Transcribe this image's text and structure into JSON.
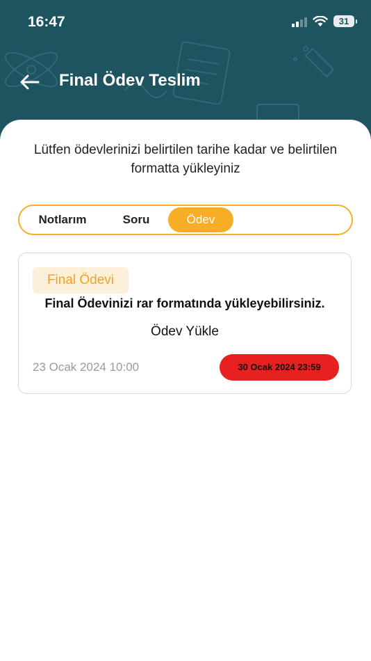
{
  "status_bar": {
    "time": "16:47",
    "battery": "31"
  },
  "header": {
    "title": "Final Ödev Teslim",
    "back_icon": "arrow-left-icon"
  },
  "intro": "Lütfen ödevlerinizi belirtilen tarihe kadar ve belirtilen formatta yükleyiniz",
  "tabs": [
    {
      "label": "Notlarım",
      "active": false
    },
    {
      "label": "Soru",
      "active": false
    },
    {
      "label": "Ödev",
      "active": true
    }
  ],
  "assignment": {
    "badge": "Final Ödevi",
    "description": "Final Ödevinizi rar formatında yükleyebilirsiniz.",
    "upload_label": "Ödev Yükle",
    "start_date": "23 Ocak 2024 10:00",
    "end_date": "30 Ocak 2024 23:59"
  },
  "colors": {
    "header": "#1d5460",
    "accent": "#f7ad25",
    "badge_bg": "#fdf0db",
    "deadline": "#e6211f"
  }
}
